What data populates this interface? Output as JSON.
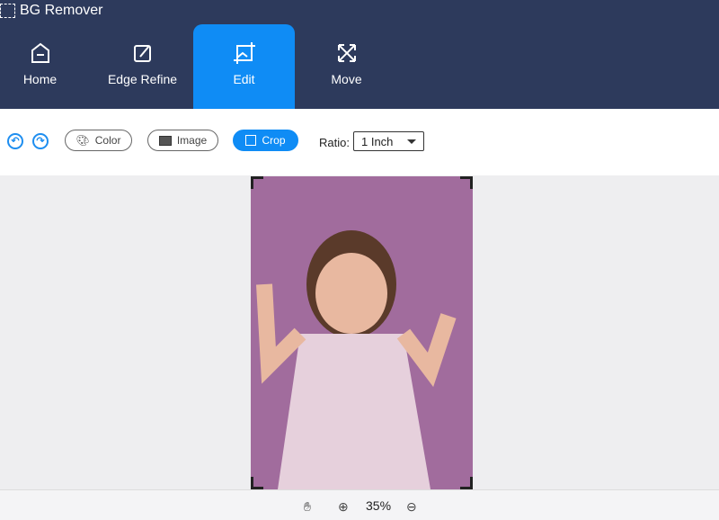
{
  "app": {
    "title": "BG Remover"
  },
  "tabs": [
    {
      "label": "Home",
      "icon": "home-icon"
    },
    {
      "label": "Edge Refine",
      "icon": "edit-icon"
    },
    {
      "label": "Edit",
      "icon": "crop-image-icon",
      "active": true
    },
    {
      "label": "Move",
      "icon": "move-icon"
    }
  ],
  "toolbar": {
    "color_label": "Color",
    "image_label": "Image",
    "crop_label": "Crop",
    "ratio_label": "Ratio:",
    "ratio_value": "1 Inch"
  },
  "footer": {
    "zoom": "35%"
  },
  "colors": {
    "header": "#2d3a5c",
    "accent": "#0f8cf5",
    "background": "#a16c9d"
  }
}
